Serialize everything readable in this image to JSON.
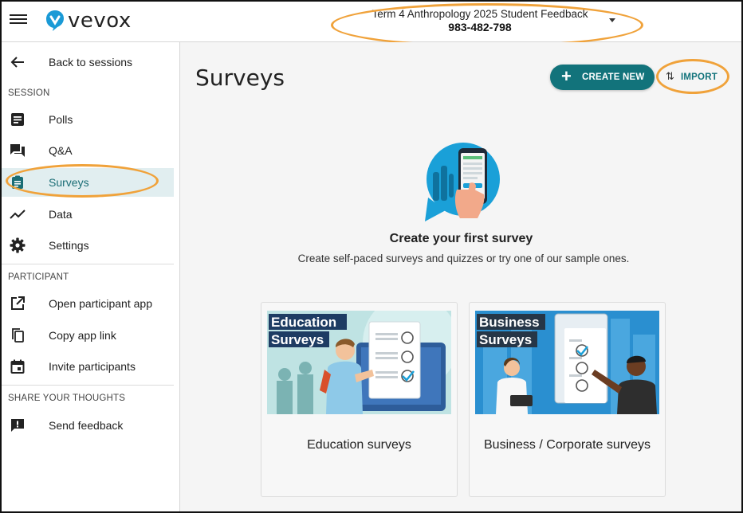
{
  "app": {
    "logo_text": "vevox"
  },
  "header": {
    "session_name": "Term 4 Anthropology 2025 Student Feedback",
    "session_code": "983-482-798"
  },
  "sidebar": {
    "back_label": "Back to sessions",
    "sections": [
      {
        "heading": "SESSION"
      },
      {
        "heading": "PARTICIPANT"
      },
      {
        "heading": "SHARE YOUR THOUGHTS"
      }
    ],
    "items": [
      {
        "label": "Polls",
        "icon": "polls-icon"
      },
      {
        "label": "Q&A",
        "icon": "qa-icon"
      },
      {
        "label": "Surveys",
        "icon": "surveys-icon",
        "active": true
      },
      {
        "label": "Data",
        "icon": "data-trend-icon"
      },
      {
        "label": "Settings",
        "icon": "gear-icon"
      },
      {
        "label": "Open participant app",
        "icon": "open-external-icon"
      },
      {
        "label": "Copy app link",
        "icon": "copy-icon"
      },
      {
        "label": "Invite participants",
        "icon": "calendar-icon"
      },
      {
        "label": "Send feedback",
        "icon": "feedback-icon"
      }
    ]
  },
  "main": {
    "title": "Surveys",
    "create_label": "CREATE NEW",
    "import_label": "IMPORT",
    "empty_title": "Create your first survey",
    "empty_subtitle": "Create self-paced surveys and quizzes or try one of our sample ones.",
    "cards": [
      {
        "image_caption": "Education Surveys",
        "label": "Education surveys"
      },
      {
        "image_caption": "Business Surveys",
        "label": "Business / Corporate surveys"
      }
    ]
  },
  "colors": {
    "accent": "#12737b",
    "active_bg": "#e1eef0",
    "highlight_ring": "#f0a23a",
    "logo_blue": "#1a9ad6"
  }
}
